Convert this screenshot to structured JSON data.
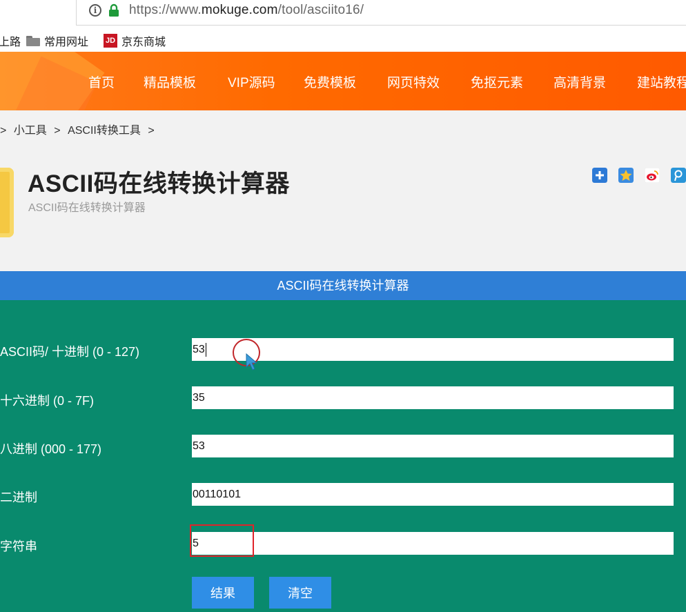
{
  "browser": {
    "url_prefix": "https://www.",
    "url_domain": "mokuge.com",
    "url_path": "/tool/asciito16/",
    "bookmarks": [
      "上路",
      "常用网址",
      "京东商城"
    ],
    "jd_logo": "JD"
  },
  "nav": {
    "items": [
      "首页",
      "精品模板",
      "VIP源码",
      "免费模板",
      "网页特效",
      "免抠元素",
      "高清背景",
      "建站教程"
    ]
  },
  "breadcrumb": [
    ">",
    "小工具",
    ">",
    "ASCII转换工具",
    ">"
  ],
  "header": {
    "title": "ASCII码在线转换计算器",
    "subtitle": "ASCII码在线转换计算器"
  },
  "share_icons": [
    "add-icon",
    "qzone-icon",
    "weibo-icon",
    "tencent-icon"
  ],
  "tool": {
    "bar_title": "ASCII码在线转换计算器",
    "fields": [
      {
        "label": "ASCII码/ 十进制 (0 - 127)",
        "value": "53"
      },
      {
        "label": "十六进制 (0 - 7F)",
        "value": "35"
      },
      {
        "label": "八进制 (000 - 177)",
        "value": "53"
      },
      {
        "label": "二进制",
        "value": "00110101"
      },
      {
        "label": "字符串",
        "value": "5"
      }
    ],
    "buttons": {
      "result": "结果",
      "clear": "清空"
    }
  },
  "colors": {
    "nav_bg": "#ff6a00",
    "title_bar": "#2f7fd6",
    "form_bg": "#098a6d",
    "button": "#2f8ee6",
    "highlight": "#e0232a"
  }
}
